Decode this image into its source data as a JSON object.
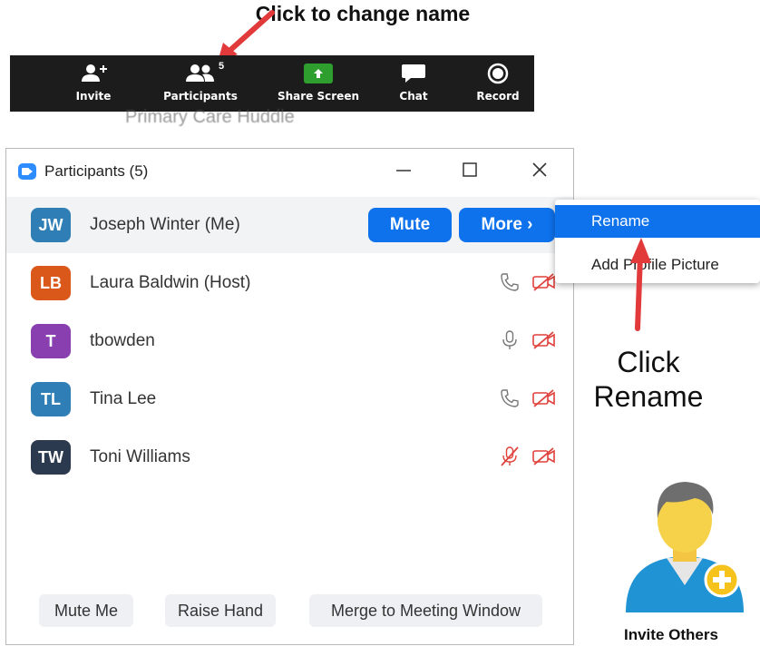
{
  "annotations": {
    "top_callout": "Click to change name",
    "right_callout": "Click Rename",
    "arrow_color": "#e23a3a"
  },
  "background_meeting_name": "Primary Care Huddle",
  "toolbar": {
    "items": [
      {
        "label": "Invite",
        "icon": "add-person-icon"
      },
      {
        "label": "Participants",
        "icon": "participants-icon",
        "count": "5"
      },
      {
        "label": "Share Screen",
        "icon": "share-screen-icon"
      },
      {
        "label": "Chat",
        "icon": "chat-icon"
      },
      {
        "label": "Record",
        "icon": "record-icon"
      }
    ],
    "share_color": "#2e9e2e"
  },
  "window": {
    "title": "Participants (5)",
    "controls": [
      "minimize",
      "maximize",
      "close"
    ]
  },
  "participants": [
    {
      "initials": "JW",
      "name": "Joseph Winter (Me)",
      "color": "#2f7fb6",
      "audio": "none",
      "video": "none"
    },
    {
      "initials": "LB",
      "name": "Laura Baldwin (Host)",
      "color": "#d9581a",
      "audio": "phone",
      "video": "off"
    },
    {
      "initials": "T",
      "name": "tbowden",
      "color": "#8a3fb0",
      "audio": "mic",
      "video": "off"
    },
    {
      "initials": "TL",
      "name": "Tina Lee",
      "color": "#2f7fb6",
      "audio": "phone",
      "video": "off"
    },
    {
      "initials": "TW",
      "name": "Toni Williams",
      "color": "#2b3a4f",
      "audio": "mic-muted",
      "video": "off"
    }
  ],
  "row_actions": {
    "mute_label": "Mute",
    "more_label": "More ›"
  },
  "bottom_buttons": {
    "mute_me": "Mute Me",
    "raise_hand": "Raise Hand",
    "merge": "Merge to Meeting Window"
  },
  "more_menu": {
    "items": [
      "Rename",
      "Add Profile Picture"
    ],
    "visible_second_label": "Add      ofile Picture"
  },
  "invite_others": {
    "label": "Invite Others"
  },
  "colors": {
    "accent_blue": "#0e72ed",
    "muted_red": "#e0413a",
    "toolbar_bg": "#1c1c1c"
  }
}
